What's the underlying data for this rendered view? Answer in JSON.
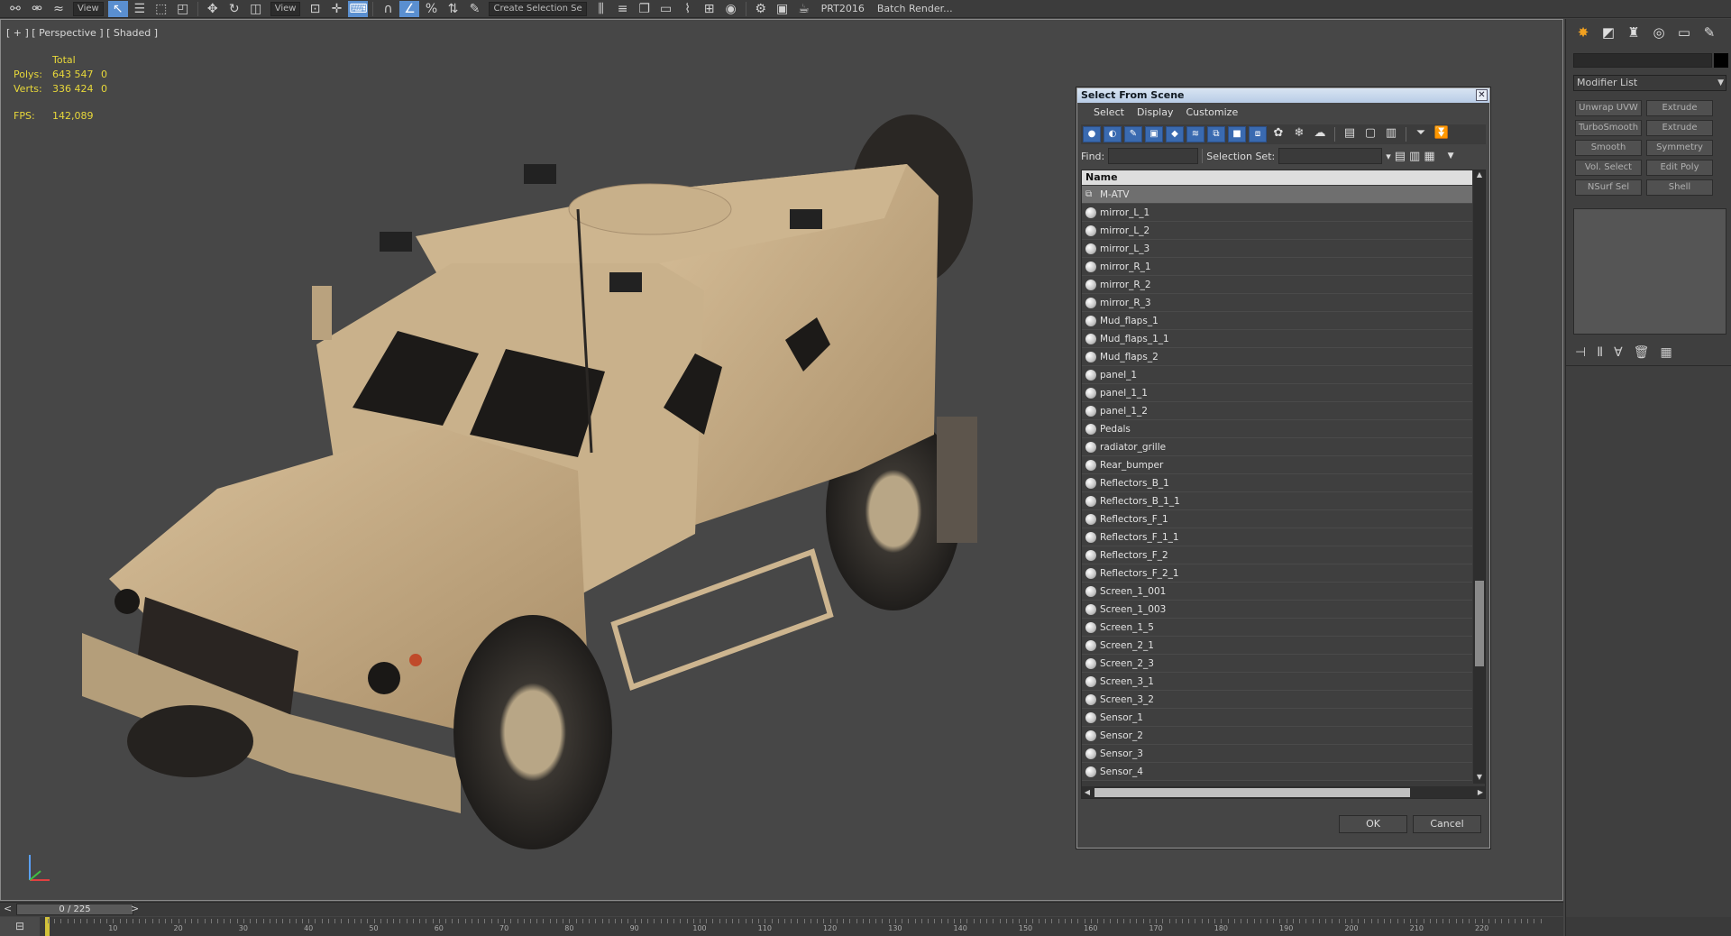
{
  "toolbar": {
    "view_dropdown": "View",
    "selection_set_dropdown": "Create Selection Se",
    "renderer": "PRT2016",
    "batch_render": "Batch Render..."
  },
  "viewport": {
    "label": "[ + ] [ Perspective ] [ Shaded ]",
    "stats": {
      "total_label": "Total",
      "polys_label": "Polys:",
      "polys_total": "643 547",
      "polys_sel": "0",
      "verts_label": "Verts:",
      "verts_total": "336 424",
      "verts_sel": "0",
      "fps_label": "FPS:",
      "fps_value": "142,089"
    }
  },
  "command_panel": {
    "modifier_list": "Modifier List",
    "buttons": [
      "Unwrap UVW",
      "Extrude",
      "TurboSmooth",
      "Extrude",
      "Smooth",
      "Symmetry",
      "Vol. Select",
      "Edit Poly",
      "NSurf Sel",
      "Shell"
    ]
  },
  "timeline": {
    "frame": "0 / 225",
    "ticks": [
      "10",
      "20",
      "30",
      "40",
      "50",
      "60",
      "70",
      "80",
      "90",
      "100",
      "110",
      "120",
      "130",
      "140",
      "150",
      "160",
      "170",
      "180",
      "190",
      "200",
      "210",
      "220"
    ]
  },
  "dialog": {
    "title": "Select From Scene",
    "menu": [
      "Select",
      "Display",
      "Customize"
    ],
    "find_label": "Find:",
    "selection_set_label": "Selection Set:",
    "column_name": "Name",
    "items": [
      "M-ATV",
      "mirror_L_1",
      "mirror_L_2",
      "mirror_L_3",
      "mirror_R_1",
      "mirror_R_2",
      "mirror_R_3",
      "Mud_flaps_1",
      "Mud_flaps_1_1",
      "Mud_flaps_2",
      "panel_1",
      "panel_1_1",
      "panel_1_2",
      "Pedals",
      "radiator_grille",
      "Rear_bumper",
      "Reflectors_B_1",
      "Reflectors_B_1_1",
      "Reflectors_F_1",
      "Reflectors_F_1_1",
      "Reflectors_F_2",
      "Reflectors_F_2_1",
      "Screen_1_001",
      "Screen_1_003",
      "Screen_1_5",
      "Screen_2_1",
      "Screen_2_3",
      "Screen_3_1",
      "Screen_3_2",
      "Sensor_1",
      "Sensor_2",
      "Sensor_3",
      "Sensor_4"
    ],
    "ok": "OK",
    "cancel": "Cancel"
  }
}
